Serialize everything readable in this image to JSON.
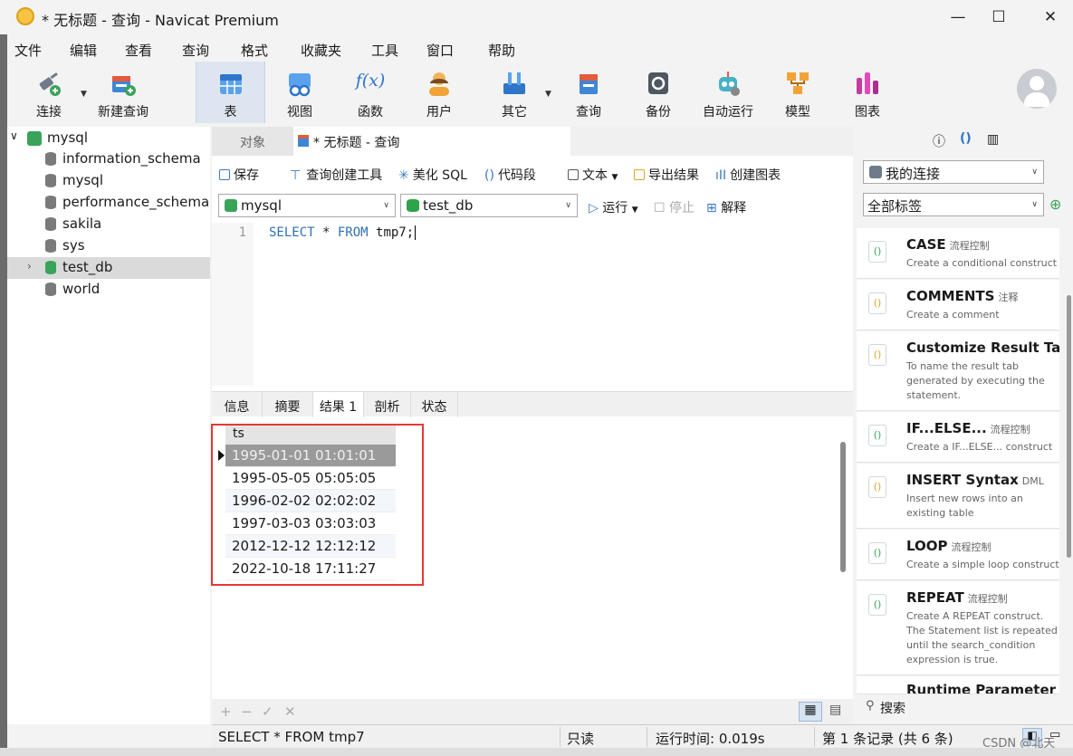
{
  "window": {
    "title": "* 无标题 - 查询 - Navicat Premium",
    "min": "—",
    "max": "☐",
    "close": "✕"
  },
  "menu": [
    "文件",
    "编辑",
    "查看",
    "查询",
    "格式",
    "收藏夹",
    "工具",
    "窗口",
    "帮助"
  ],
  "toolbar": {
    "items": [
      {
        "label": "连接",
        "icon": "plug-icon"
      },
      {
        "label": "新建查询",
        "icon": "new-query-icon"
      },
      {
        "label": "表",
        "icon": "table-icon"
      },
      {
        "label": "视图",
        "icon": "view-icon"
      },
      {
        "label": "函数",
        "icon": "function-icon",
        "glyph": "f(x)"
      },
      {
        "label": "用户",
        "icon": "user-icon"
      },
      {
        "label": "其它",
        "icon": "tools-icon"
      },
      {
        "label": "查询",
        "icon": "query-icon"
      },
      {
        "label": "备份",
        "icon": "backup-icon"
      },
      {
        "label": "自动运行",
        "icon": "robot-icon"
      },
      {
        "label": "模型",
        "icon": "model-icon"
      },
      {
        "label": "图表",
        "icon": "chart-icon"
      }
    ]
  },
  "tree": {
    "root": "mysql",
    "items": [
      "information_schema",
      "mysql",
      "performance_schema",
      "sakila",
      "sys",
      "test_db",
      "world"
    ],
    "selected": "test_db"
  },
  "tabs": {
    "objects": "对象",
    "query": "* 无标题 - 查询"
  },
  "query_toolbar": {
    "save": "保存",
    "builder": "查询创建工具",
    "beautify": "美化 SQL",
    "snippet": "代码段",
    "text": "文本",
    "export": "导出结果",
    "chart": "创建图表",
    "run": "运行",
    "stop": "停止",
    "explain": "解释"
  },
  "connection_combo": "mysql",
  "database_combo": "test_db",
  "editor": {
    "line": "1",
    "sql_kw1": "SELECT",
    "sql_mid": " * ",
    "sql_kw2": "FROM",
    "sql_rest": " tmp7;"
  },
  "result_tabs": [
    "信息",
    "摘要",
    "结果 1",
    "剖析",
    "状态"
  ],
  "result": {
    "column": "ts",
    "rows": [
      "1995-01-01 01:01:01",
      "1995-05-05 05:05:05",
      "1996-02-02 02:02:02",
      "1997-03-03 03:03:03",
      "2012-12-12 12:12:12",
      "2022-10-18 17:11:27"
    ]
  },
  "grid_footer": {
    "add": "+",
    "remove": "−",
    "apply": "✓",
    "discard": "✕"
  },
  "right_panel": {
    "connection": "我的连接",
    "tags": "全部标签",
    "search": "搜索",
    "snippets": [
      {
        "title": "CASE",
        "tag": "流程控制",
        "desc": "Create a conditional construct"
      },
      {
        "title": "COMMENTS",
        "tag": "注释",
        "desc": "Create a comment"
      },
      {
        "title": "Customize Result Tab N",
        "tag": "",
        "desc": "To name the result tab generated by executing the statement."
      },
      {
        "title": "IF...ELSE...",
        "tag": "流程控制",
        "desc": "Create a IF...ELSE... construct"
      },
      {
        "title": "INSERT Syntax",
        "tag": "DML",
        "desc": "Insert new rows into an existing table"
      },
      {
        "title": "LOOP",
        "tag": "流程控制",
        "desc": "Create a simple loop construct"
      },
      {
        "title": "REPEAT",
        "tag": "流程控制",
        "desc": "Create A REPEAT construct. The Statement list is repeated until the search_condition expression is true."
      },
      {
        "title": "Runtime Parameter",
        "tag": "",
        "desc": ""
      }
    ]
  },
  "status": {
    "sql": "SELECT * FROM tmp7",
    "mode": "只读",
    "time": "运行时间: 0.019s",
    "record": "第 1 条记录 (共 6 条)"
  },
  "watermark": "CSDN @北天"
}
